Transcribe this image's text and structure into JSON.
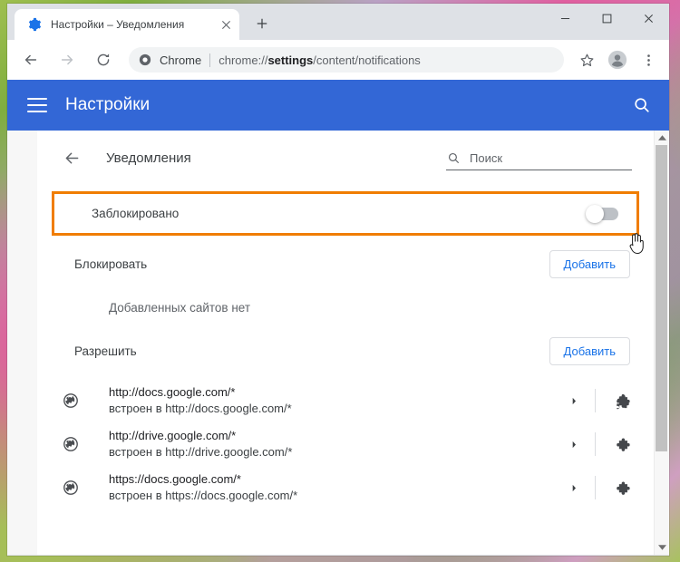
{
  "window": {
    "minimize_label": "—",
    "maximize_label": "□",
    "close_label": "✕"
  },
  "tab": {
    "title": "Настройки – Уведомления",
    "favicon": "gear-icon",
    "close_label": "✕",
    "newtab_label": "+"
  },
  "toolbar": {
    "back_label": "←",
    "forward_label": "→",
    "reload_label": "⟳",
    "omnibox": {
      "scheme_chip": "Chrome",
      "url_prefix": "chrome://",
      "url_bold": "settings",
      "url_suffix": "/content/notifications",
      "full_url": "chrome://settings/content/notifications"
    },
    "bookmark_icon": "star-icon",
    "profile_icon": "avatar-icon",
    "menu_icon": "three-dots-icon"
  },
  "settings_header": {
    "menu_icon": "hamburger-icon",
    "title": "Настройки",
    "search_icon": "search-icon",
    "background_color": "#3367d6"
  },
  "page": {
    "back_icon": "back-arrow-icon",
    "title": "Уведомления",
    "search": {
      "icon": "search-icon",
      "placeholder": "Поиск",
      "value": ""
    }
  },
  "toggle_row": {
    "label": "Заблокировано",
    "state": "off",
    "highlight_color": "#f07d00"
  },
  "sections": [
    {
      "title": "Блокировать",
      "add_label": "Добавить",
      "empty_text": "Добавленных сайтов нет",
      "sites": []
    },
    {
      "title": "Разрешить",
      "add_label": "Добавить",
      "empty_text": "",
      "sites": [
        {
          "icon": "globe-icon",
          "url": "http://docs.google.com/*",
          "sub": "встроен в http://docs.google.com/*",
          "expand_icon": "chevron-right-icon",
          "source_icon": "puzzle-icon"
        },
        {
          "icon": "globe-icon",
          "url": "http://drive.google.com/*",
          "sub": "встроен в http://drive.google.com/*",
          "expand_icon": "chevron-right-icon",
          "source_icon": "puzzle-icon"
        },
        {
          "icon": "globe-icon",
          "url": "https://docs.google.com/*",
          "sub": "встроен в https://docs.google.com/*",
          "expand_icon": "chevron-right-icon",
          "source_icon": "puzzle-icon"
        }
      ]
    }
  ],
  "scrollbar": {
    "up_arrow": "▲",
    "down_arrow": "▼"
  },
  "cursor": {
    "type": "pointer-hand-cursor"
  },
  "colors": {
    "accent_blue": "#1a73e8",
    "header_blue": "#3367d6",
    "highlight_orange": "#f07d00",
    "toggle_track_off": "#bdc1c6"
  }
}
